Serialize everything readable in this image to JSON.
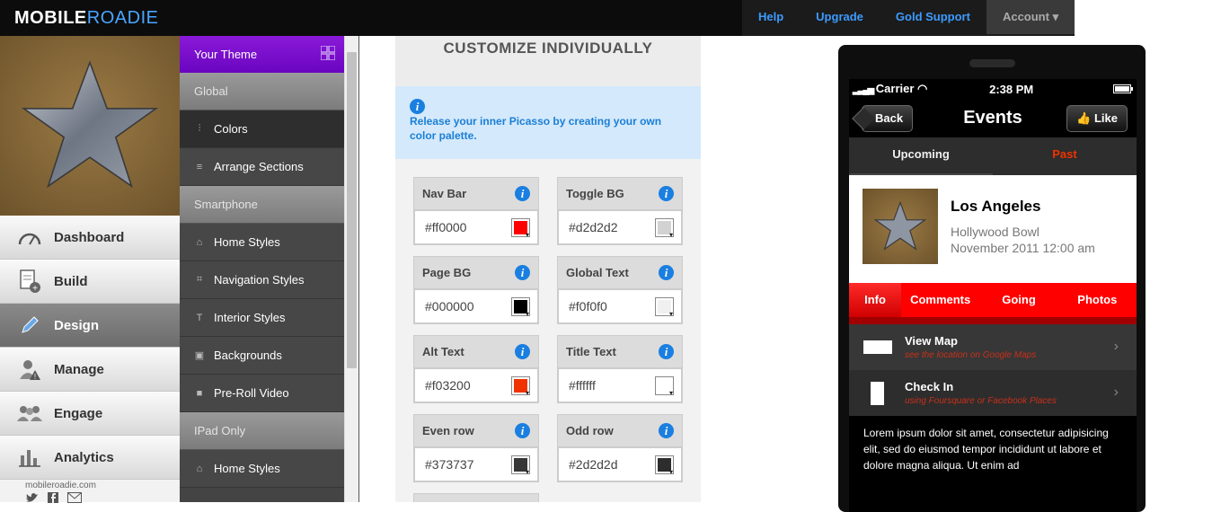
{
  "brand": {
    "part1": "MOBILE",
    "part2": "ROADIE"
  },
  "topnav": {
    "help": "Help",
    "upgrade": "Upgrade",
    "gold_support": "Gold Support",
    "account": "Account ▾"
  },
  "mainnav": {
    "items": [
      {
        "label": "Dashboard",
        "icon": "gauge-icon"
      },
      {
        "label": "Build",
        "icon": "document-add-icon"
      },
      {
        "label": "Design",
        "icon": "pencil-icon"
      },
      {
        "label": "Manage",
        "icon": "user-alert-icon"
      },
      {
        "label": "Engage",
        "icon": "people-icon"
      },
      {
        "label": "Analytics",
        "icon": "bar-chart-icon"
      }
    ],
    "active": "Design"
  },
  "footer": {
    "site": "mobileroadie.com",
    "social": [
      "twitter-icon",
      "facebook-icon",
      "email-icon"
    ]
  },
  "subnav": {
    "header": "Your Theme",
    "sections": [
      {
        "title": "Global",
        "items": [
          "Colors",
          "Arrange Sections"
        ]
      },
      {
        "title": "Smartphone",
        "items": [
          "Home Styles",
          "Navigation Styles",
          "Interior Styles",
          "Backgrounds",
          "Pre-Roll Video"
        ]
      },
      {
        "title": "IPad Only",
        "items": [
          "Home Styles"
        ]
      }
    ],
    "active_item": "Colors"
  },
  "panel": {
    "title": "CUSTOMIZE INDIVIDUALLY",
    "info": "Release your inner Picasso by creating your own color palette.",
    "colors": [
      {
        "label": "Nav Bar",
        "value": "#ff0000"
      },
      {
        "label": "Toggle BG",
        "value": "#d2d2d2"
      },
      {
        "label": "Page BG",
        "value": "#000000"
      },
      {
        "label": "Global Text",
        "value": "#f0f0f0"
      },
      {
        "label": "Alt Text",
        "value": "#f03200"
      },
      {
        "label": "Title Text",
        "value": "#ffffff"
      },
      {
        "label": "Even row",
        "value": "#373737"
      },
      {
        "label": "Odd row",
        "value": "#2d2d2d"
      }
    ]
  },
  "phone": {
    "carrier": "Carrier",
    "time": "2:38 PM",
    "back": "Back",
    "title": "Events",
    "like": "Like",
    "toggle": {
      "upcoming": "Upcoming",
      "past": "Past"
    },
    "event": {
      "title": "Los Angeles",
      "venue": "Hollywood Bowl",
      "date": "November 2011 12:00 am"
    },
    "tabs": [
      "Info",
      "Comments",
      "Going",
      "Photos"
    ],
    "rows": [
      {
        "title": "View Map",
        "subtitle": "see the location on Google Maps"
      },
      {
        "title": "Check In",
        "subtitle": "using Foursquare or Facebook Places"
      }
    ],
    "body": "Lorem ipsum dolor sit amet, consectetur adipisicing elit, sed do eiusmod tempor incididunt ut labore et dolore magna aliqua. Ut enim ad"
  }
}
